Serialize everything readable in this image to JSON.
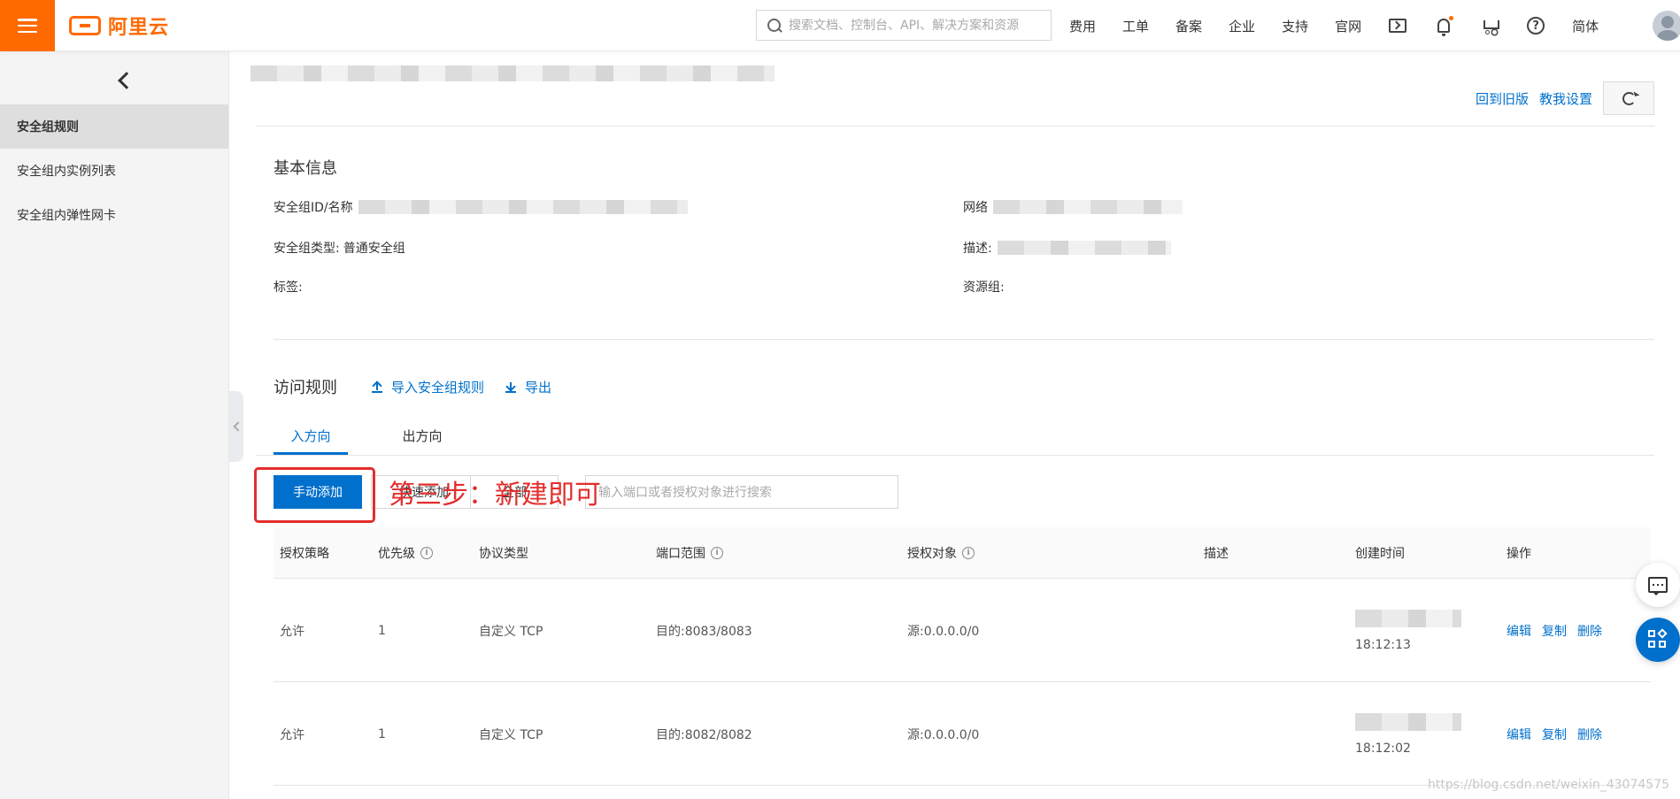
{
  "topbar": {
    "logo_text": "阿里云",
    "search_placeholder": "搜索文档、控制台、API、解决方案和资源",
    "nav_items": [
      "费用",
      "工单",
      "备案",
      "企业",
      "支持",
      "官网"
    ],
    "lang_label": "简体",
    "brand_color": "#ff6a00"
  },
  "sidebar": {
    "items": [
      {
        "label": "安全组规则",
        "active": true
      },
      {
        "label": "安全组内实例列表",
        "active": false
      },
      {
        "label": "安全组内弹性网卡",
        "active": false
      }
    ]
  },
  "header": {
    "back_to_old_label": "回到旧版",
    "tutorial_settings_label": "教我设置"
  },
  "basic_info": {
    "title": "基本信息",
    "sg_id_name_label": "安全组ID/名称",
    "network_label": "网络",
    "sg_type_label": "安全组类型:",
    "sg_type_value": "普通安全组",
    "description_label": "描述:",
    "tags_label": "标签:",
    "resource_group_label": "资源组:"
  },
  "access_rules": {
    "title": "访问规则",
    "import_label": "导入安全组规则",
    "export_label": "导出",
    "tabs": [
      {
        "label": "入方向",
        "active": true
      },
      {
        "label": "出方向",
        "active": false
      }
    ],
    "manual_add_label": "手动添加",
    "quick_add_label": "快速添加",
    "all_label": "全部",
    "search_placeholder": "输入端口或者授权对象进行搜索",
    "annotation": "第三步：新建即可",
    "accent_color": "#0070cc",
    "annotation_color": "#e32d2d"
  },
  "table": {
    "headers": [
      "授权策略",
      "优先级",
      "协议类型",
      "端口范围",
      "授权对象",
      "描述",
      "创建时间",
      "操作"
    ],
    "rows": [
      {
        "policy": "允许",
        "priority": "1",
        "protocol": "自定义 TCP",
        "port": "目的:8083/8083",
        "source": "源:0.0.0.0/0",
        "description": "",
        "time": "18:12:13"
      },
      {
        "policy": "允许",
        "priority": "1",
        "protocol": "自定义 TCP",
        "port": "目的:8082/8082",
        "source": "源:0.0.0.0/0",
        "description": "",
        "time": "18:12:02"
      }
    ],
    "actions": [
      "编辑",
      "复制",
      "删除"
    ]
  },
  "watermark": "https://blog.csdn.net/weixin_43074575"
}
